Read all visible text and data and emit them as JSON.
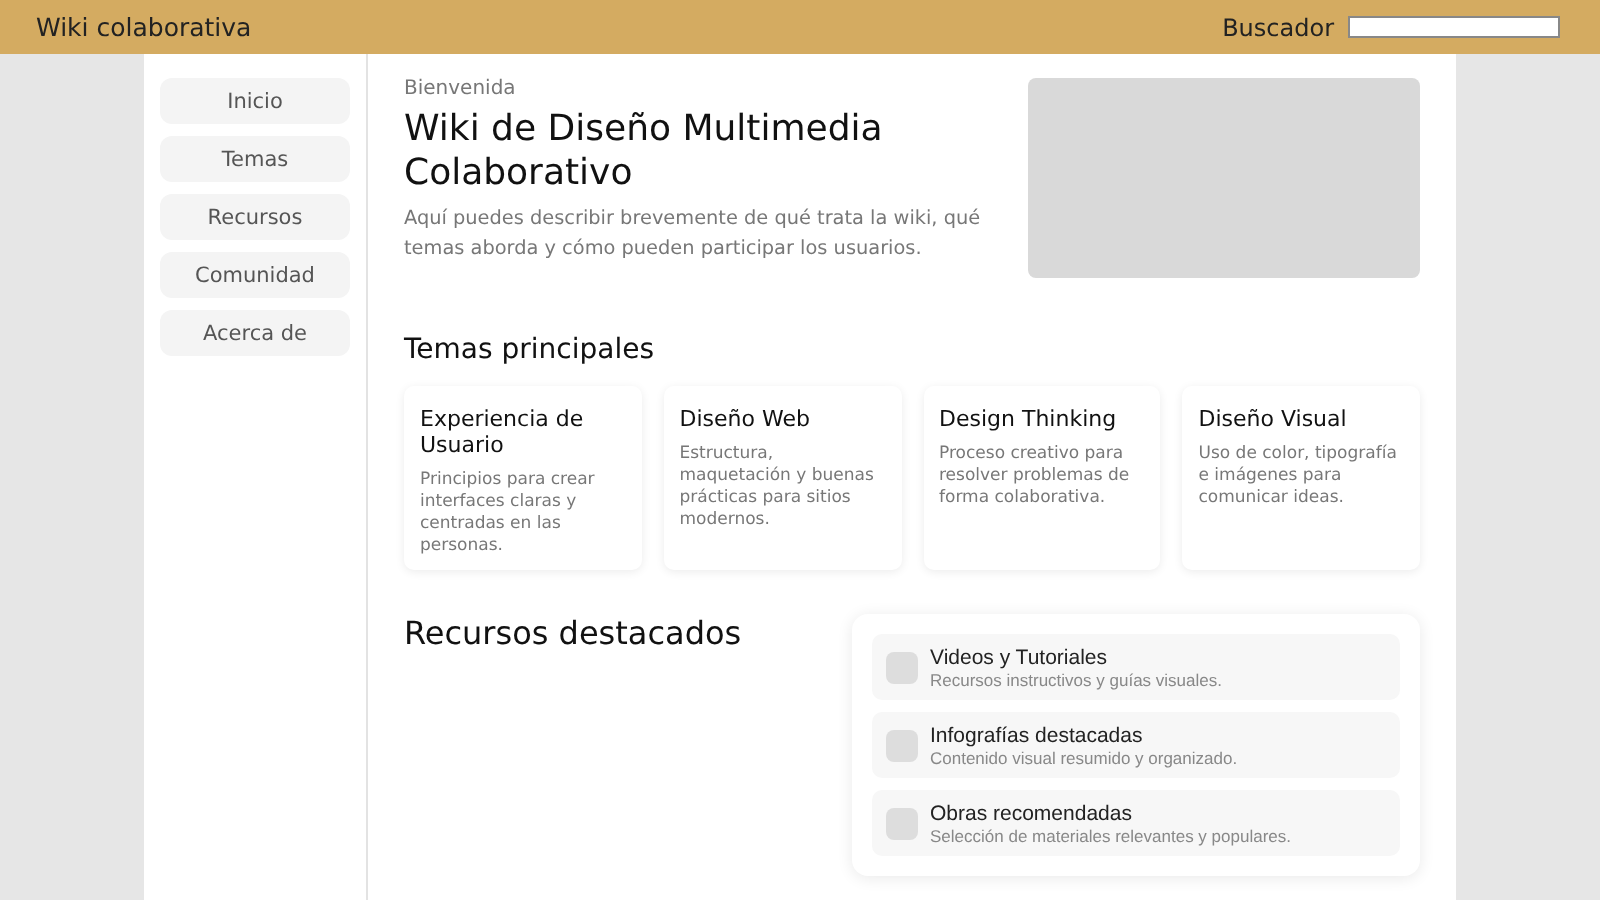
{
  "header": {
    "title": "Wiki colaborativa",
    "search_label": "Buscador"
  },
  "sidebar": {
    "items": [
      "Inicio",
      "Temas",
      "Recursos",
      "Comunidad",
      "Acerca de"
    ]
  },
  "hero": {
    "eyebrow": "Bienvenida",
    "title": "Wiki de Diseño Multimedia Colaborativo",
    "description": "Aquí puedes describir brevemente de qué trata la wiki, qué temas aborda y cómo pueden participar los usuarios."
  },
  "topics": {
    "heading": "Temas principales",
    "cards": [
      {
        "title": "Experiencia de Usuario",
        "text": "Principios para crear interfaces claras y centradas en las personas."
      },
      {
        "title": "Diseño Web",
        "text": "Estructura, maquetación y buenas prácticas para sitios modernos."
      },
      {
        "title": "Design Thinking",
        "text": "Proceso creativo para resolver problemas de forma colaborativa."
      },
      {
        "title": "Diseño Visual",
        "text": "Uso de color, tipografía e imágenes para comunicar ideas."
      }
    ]
  },
  "resources": {
    "heading": "Recursos destacados",
    "items": [
      {
        "title": "Videos y Tutoriales",
        "text": "Recursos instructivos y guías visuales."
      },
      {
        "title": "Infografías destacadas",
        "text": "Contenido visual resumido y organizado."
      },
      {
        "title": "Obras recomendadas",
        "text": "Selección de materiales relevantes y populares."
      }
    ]
  }
}
